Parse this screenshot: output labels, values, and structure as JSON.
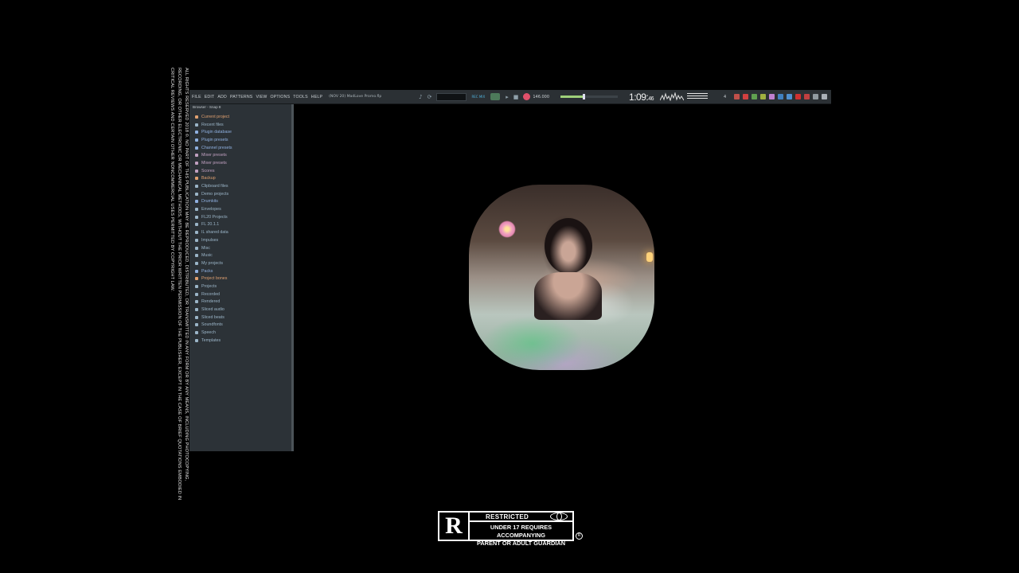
{
  "legal_text": [
    "ALL RIGHTS RESERVED 2018 ©. NO PART OF THIS PUBLICATION MAY BE REPRODUCED, DISTRIBUTED, OR TRANSMITTED IN ANY FORM OR BY ANY MEANS, INCLUDING PHOTOCOPYING,",
    "RECORDING, OR OTHER ELECTRONIC OR MECHANICAL METHODS, WITHOUT THE PRIOR WRITTEN PERMISSION OF THE PUBLISHER, EXCEPT IN THE CASE OF BRIEF QUOTATIONS EMBODIED IN",
    "CRITICAL REVIEWS AND CERTAIN OTHER NONCOMMERCIAL USES PERMITTED BY COPYRIGHT LAW."
  ],
  "toolbar": {
    "menu": [
      "FILE",
      "EDIT",
      "ADD",
      "PATTERNS",
      "VIEW",
      "OPTIONS",
      "TOOLS",
      "HELP"
    ],
    "project_title": "(NOV 20) MadLove Promo.flp",
    "rec_mix": "REC MIX",
    "bpm": "146.000",
    "time_main": "1:09:",
    "time_small": "46",
    "time_label": "M:S:CS",
    "pattern_num": "4",
    "master_level": 0.4
  },
  "browser": {
    "header": "Browser - Snap 8",
    "items": [
      {
        "label": "Current project",
        "color": "#e0a070"
      },
      {
        "label": "Recent files",
        "color": "#9bb5c8"
      },
      {
        "label": "Plugin database",
        "color": "#8fb0e0"
      },
      {
        "label": "Plugin presets",
        "color": "#8fb0e0"
      },
      {
        "label": "Channel presets",
        "color": "#8fb0e0"
      },
      {
        "label": "Mixer presets",
        "color": "#c0a0c0"
      },
      {
        "label": "Mixer presets",
        "color": "#c0a0c0"
      },
      {
        "label": "Scores",
        "color": "#c0a0c0"
      },
      {
        "label": "Backup",
        "color": "#e0a070"
      },
      {
        "label": "Clipboard files",
        "color": "#9bb5c8"
      },
      {
        "label": "Demo projects",
        "color": "#9bb5c8"
      },
      {
        "label": "Drumkits",
        "color": "#8fb0e0"
      },
      {
        "label": "Envelopes",
        "color": "#9bb5c8"
      },
      {
        "label": "FL20 Projects",
        "color": "#9bb5c8"
      },
      {
        "label": "FL 20.1.1",
        "color": "#9bb5c8"
      },
      {
        "label": "IL shared data",
        "color": "#9bb5c8"
      },
      {
        "label": "Impulses",
        "color": "#9bb5c8"
      },
      {
        "label": "Misc",
        "color": "#9bb5c8"
      },
      {
        "label": "Music",
        "color": "#9bb5c8"
      },
      {
        "label": "My projects",
        "color": "#9bb5c8"
      },
      {
        "label": "Packs",
        "color": "#8fb0e0"
      },
      {
        "label": "Project bones",
        "color": "#e0a070"
      },
      {
        "label": "Projects",
        "color": "#9bb5c8"
      },
      {
        "label": "Recorded",
        "color": "#9bb5c8"
      },
      {
        "label": "Rendered",
        "color": "#9bb5c8"
      },
      {
        "label": "Sliced audio",
        "color": "#9bb5c8"
      },
      {
        "label": "Sliced beats",
        "color": "#9bb5c8"
      },
      {
        "label": "Soundfonts",
        "color": "#9bb5c8"
      },
      {
        "label": "Speech",
        "color": "#9bb5c8"
      },
      {
        "label": "Templates",
        "color": "#9bb5c8"
      }
    ]
  },
  "rating": {
    "letter": "R",
    "label": "RESTRICTED",
    "desc_line1": "UNDER 17 REQUIRES ACCOMPANYING",
    "desc_line2": "PARENT OR ADULT GUARDIAN",
    "reg": "R"
  }
}
